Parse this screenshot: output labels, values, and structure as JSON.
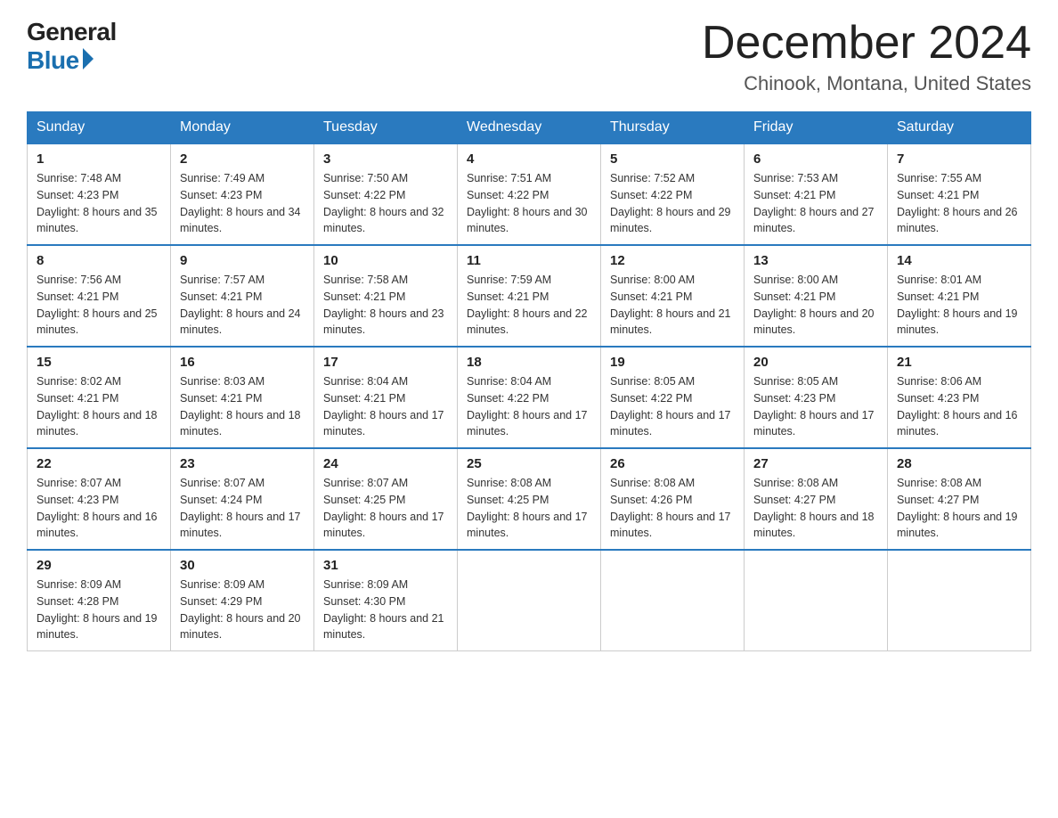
{
  "logo": {
    "general": "General",
    "blue": "Blue"
  },
  "header": {
    "month": "December 2024",
    "location": "Chinook, Montana, United States"
  },
  "weekdays": [
    "Sunday",
    "Monday",
    "Tuesday",
    "Wednesday",
    "Thursday",
    "Friday",
    "Saturday"
  ],
  "weeks": [
    [
      {
        "day": "1",
        "sunrise": "7:48 AM",
        "sunset": "4:23 PM",
        "daylight": "8 hours and 35 minutes."
      },
      {
        "day": "2",
        "sunrise": "7:49 AM",
        "sunset": "4:23 PM",
        "daylight": "8 hours and 34 minutes."
      },
      {
        "day": "3",
        "sunrise": "7:50 AM",
        "sunset": "4:22 PM",
        "daylight": "8 hours and 32 minutes."
      },
      {
        "day": "4",
        "sunrise": "7:51 AM",
        "sunset": "4:22 PM",
        "daylight": "8 hours and 30 minutes."
      },
      {
        "day": "5",
        "sunrise": "7:52 AM",
        "sunset": "4:22 PM",
        "daylight": "8 hours and 29 minutes."
      },
      {
        "day": "6",
        "sunrise": "7:53 AM",
        "sunset": "4:21 PM",
        "daylight": "8 hours and 27 minutes."
      },
      {
        "day": "7",
        "sunrise": "7:55 AM",
        "sunset": "4:21 PM",
        "daylight": "8 hours and 26 minutes."
      }
    ],
    [
      {
        "day": "8",
        "sunrise": "7:56 AM",
        "sunset": "4:21 PM",
        "daylight": "8 hours and 25 minutes."
      },
      {
        "day": "9",
        "sunrise": "7:57 AM",
        "sunset": "4:21 PM",
        "daylight": "8 hours and 24 minutes."
      },
      {
        "day": "10",
        "sunrise": "7:58 AM",
        "sunset": "4:21 PM",
        "daylight": "8 hours and 23 minutes."
      },
      {
        "day": "11",
        "sunrise": "7:59 AM",
        "sunset": "4:21 PM",
        "daylight": "8 hours and 22 minutes."
      },
      {
        "day": "12",
        "sunrise": "8:00 AM",
        "sunset": "4:21 PM",
        "daylight": "8 hours and 21 minutes."
      },
      {
        "day": "13",
        "sunrise": "8:00 AM",
        "sunset": "4:21 PM",
        "daylight": "8 hours and 20 minutes."
      },
      {
        "day": "14",
        "sunrise": "8:01 AM",
        "sunset": "4:21 PM",
        "daylight": "8 hours and 19 minutes."
      }
    ],
    [
      {
        "day": "15",
        "sunrise": "8:02 AM",
        "sunset": "4:21 PM",
        "daylight": "8 hours and 18 minutes."
      },
      {
        "day": "16",
        "sunrise": "8:03 AM",
        "sunset": "4:21 PM",
        "daylight": "8 hours and 18 minutes."
      },
      {
        "day": "17",
        "sunrise": "8:04 AM",
        "sunset": "4:21 PM",
        "daylight": "8 hours and 17 minutes."
      },
      {
        "day": "18",
        "sunrise": "8:04 AM",
        "sunset": "4:22 PM",
        "daylight": "8 hours and 17 minutes."
      },
      {
        "day": "19",
        "sunrise": "8:05 AM",
        "sunset": "4:22 PM",
        "daylight": "8 hours and 17 minutes."
      },
      {
        "day": "20",
        "sunrise": "8:05 AM",
        "sunset": "4:23 PM",
        "daylight": "8 hours and 17 minutes."
      },
      {
        "day": "21",
        "sunrise": "8:06 AM",
        "sunset": "4:23 PM",
        "daylight": "8 hours and 16 minutes."
      }
    ],
    [
      {
        "day": "22",
        "sunrise": "8:07 AM",
        "sunset": "4:23 PM",
        "daylight": "8 hours and 16 minutes."
      },
      {
        "day": "23",
        "sunrise": "8:07 AM",
        "sunset": "4:24 PM",
        "daylight": "8 hours and 17 minutes."
      },
      {
        "day": "24",
        "sunrise": "8:07 AM",
        "sunset": "4:25 PM",
        "daylight": "8 hours and 17 minutes."
      },
      {
        "day": "25",
        "sunrise": "8:08 AM",
        "sunset": "4:25 PM",
        "daylight": "8 hours and 17 minutes."
      },
      {
        "day": "26",
        "sunrise": "8:08 AM",
        "sunset": "4:26 PM",
        "daylight": "8 hours and 17 minutes."
      },
      {
        "day": "27",
        "sunrise": "8:08 AM",
        "sunset": "4:27 PM",
        "daylight": "8 hours and 18 minutes."
      },
      {
        "day": "28",
        "sunrise": "8:08 AM",
        "sunset": "4:27 PM",
        "daylight": "8 hours and 19 minutes."
      }
    ],
    [
      {
        "day": "29",
        "sunrise": "8:09 AM",
        "sunset": "4:28 PM",
        "daylight": "8 hours and 19 minutes."
      },
      {
        "day": "30",
        "sunrise": "8:09 AM",
        "sunset": "4:29 PM",
        "daylight": "8 hours and 20 minutes."
      },
      {
        "day": "31",
        "sunrise": "8:09 AM",
        "sunset": "4:30 PM",
        "daylight": "8 hours and 21 minutes."
      },
      null,
      null,
      null,
      null
    ]
  ],
  "labels": {
    "sunrise": "Sunrise:",
    "sunset": "Sunset:",
    "daylight": "Daylight:"
  }
}
